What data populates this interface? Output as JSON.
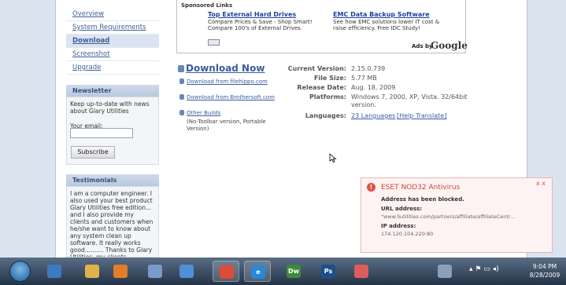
{
  "sidebar": {
    "links": [
      "Overview",
      "System Requirements",
      "Download",
      "Screenshot",
      "Upgrade"
    ],
    "active_index": 2,
    "newsletter": {
      "heading": "Newsletter",
      "text": "Keep up-to-date with news about Glary Utilities",
      "email_label": "Your email:",
      "email_value": "",
      "subscribe_label": "Subscribe"
    },
    "testimonials": {
      "heading": "Testimonials",
      "text": "I am a computer engineer. I also used your best product Glary Utilities free edition... and I also provide my clients and customers when he/she want to know about any system clean up software. It really works good.......... Thanks to Glary Utilities. my clients"
    }
  },
  "sponsored": {
    "heading": "Sponsored Links",
    "ads": [
      {
        "title": "Top External Hard Drives",
        "desc": "Compare Prices & Save - Shop Smart! Compare 100's of External Drives."
      },
      {
        "title": "EMC Data Backup Software",
        "desc": "See how EMC solutions lower IT cost & raise efficiency. Free IDC Study!"
      }
    ],
    "ads_by": "Ads by",
    "google": "Google"
  },
  "download": {
    "main": "Download Now",
    "alt1": "Download from filehippo.com",
    "alt2": "Download from Brothersoft.com",
    "other": "Other Builds",
    "other_note": "(No-Toolbar version, Portable Version)"
  },
  "info": {
    "version_label": "Current Version:",
    "version": "2.15.0.739",
    "size_label": "File Size:",
    "size": "5.77 MB",
    "date_label": "Release Date:",
    "date": "Aug. 18, 2009",
    "platforms_label": "Platforms:",
    "platforms_1": "Windows 7, 2000, XP, Vista. 32/64bit",
    "platforms_2": "version.",
    "languages_label": "Languages:",
    "languages": "23 Languages",
    "help_translate": "[Help Translate]"
  },
  "notification": {
    "title": "ESET NOD32 Antivirus",
    "close": "x x",
    "line1": "Address has been blocked.",
    "url_label": "URL address:",
    "url": "\"www.liutilities.com/partners/affiliate/affiliateCentr...",
    "ip_label": "IP address:",
    "ip": "174.120.104.220:80"
  },
  "taskbar": {
    "apps": [
      {
        "name": "media",
        "color": "#3e7ac2",
        "label": ""
      },
      {
        "name": "explorer",
        "color": "#e0b24a",
        "label": ""
      },
      {
        "name": "player",
        "color": "#e57c28",
        "label": ""
      },
      {
        "name": "network",
        "color": "#7a9ac8",
        "label": ""
      },
      {
        "name": "tools",
        "color": "#4f8fd6",
        "label": ""
      },
      {
        "name": "chrome",
        "color": "#dd4b39",
        "label": ""
      },
      {
        "name": "ie",
        "color": "#2a88d8",
        "label": "e"
      },
      {
        "name": "dreamweaver",
        "color": "#3d8a3a",
        "label": "Dw"
      },
      {
        "name": "photoshop",
        "color": "#1b4f8c",
        "label": "Ps"
      },
      {
        "name": "paint",
        "color": "#e05c5c",
        "label": ""
      },
      {
        "name": "recycle",
        "color": "#8aa0b8",
        "label": ""
      }
    ],
    "time": "9:04 PM",
    "date": "8/28/2009"
  },
  "colors": {
    "link": "#3a5d9c",
    "alert": "#d0453a"
  }
}
